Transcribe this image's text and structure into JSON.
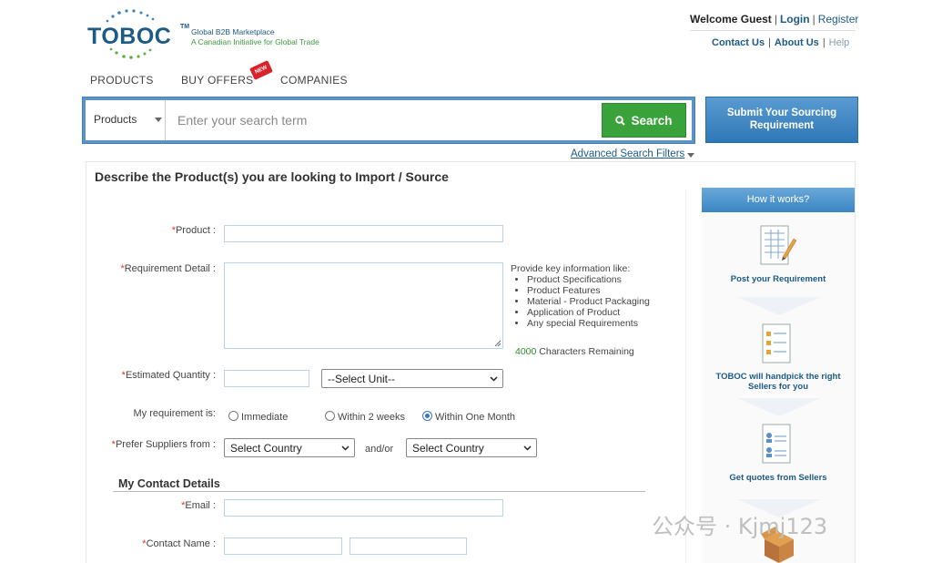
{
  "logo": {
    "name": "TOBOC",
    "tm": "TM",
    "tagline1": "Global B2B Marketplace",
    "tagline2": "A Canadian Initiative for Global Trade"
  },
  "header": {
    "welcome": "Welcome Guest",
    "login": "Login",
    "register": "Register",
    "contact_us": "Contact Us",
    "about_us": "About Us",
    "help": "Help",
    "separator": "|"
  },
  "nav": {
    "tabs": [
      {
        "label": "PRODUCTS"
      },
      {
        "label": "BUY OFFERS"
      },
      {
        "label": "COMPANIES"
      }
    ],
    "new_badge": "NEW"
  },
  "search": {
    "category": "Products",
    "placeholder": "Enter your search term",
    "value": "",
    "button": "Search",
    "submit_requirement": "Submit Your Sourcing Requirement",
    "advanced": "Advanced Search Filters"
  },
  "form": {
    "title": "Describe the Product(s) you are looking to Import / Source",
    "required_mark": "*",
    "product_label": "Product :",
    "requirement_label": "Requirement Detail :",
    "quantity_label": "Estimated Quantity :",
    "unit_select": "--Select Unit--",
    "requirement_is_label": "My requirement is:",
    "radio_options": [
      {
        "label": "Immediate",
        "checked": false
      },
      {
        "label": "Within 2 weeks",
        "checked": false
      },
      {
        "label": "Within One Month",
        "checked": true
      }
    ],
    "suppliers_label": "Prefer Suppliers from :",
    "country_select_1": "Select Country",
    "andor": "and/or",
    "country_select_2": "Select Country",
    "hint_title": "Provide key information like:",
    "hint_items": [
      "Product Specifications",
      "Product Features",
      "Material - Product Packaging",
      "Application of Product",
      "Any special Requirements"
    ],
    "chars_remaining_num": "4000",
    "chars_remaining_text": "Characters Remaining",
    "contact_section": "My Contact Details",
    "email_label": "Email :",
    "contact_name_label": "Contact Name :"
  },
  "how_it_works": {
    "title": "How it works?",
    "steps": [
      {
        "label": "Post your Requirement",
        "icon": "document-pen-icon"
      },
      {
        "label": "TOBOC will handpick the right Sellers for you",
        "icon": "document-list-icon"
      },
      {
        "label": "Get quotes from Sellers",
        "icon": "document-users-icon"
      },
      {
        "label": "",
        "icon": "box-icon"
      }
    ]
  },
  "watermark": "公众号 · Kjmj123",
  "colors": {
    "brand_blue": "#1d5a85",
    "search_green": "#3aa23a",
    "bar_blue": "#5b93c4"
  }
}
